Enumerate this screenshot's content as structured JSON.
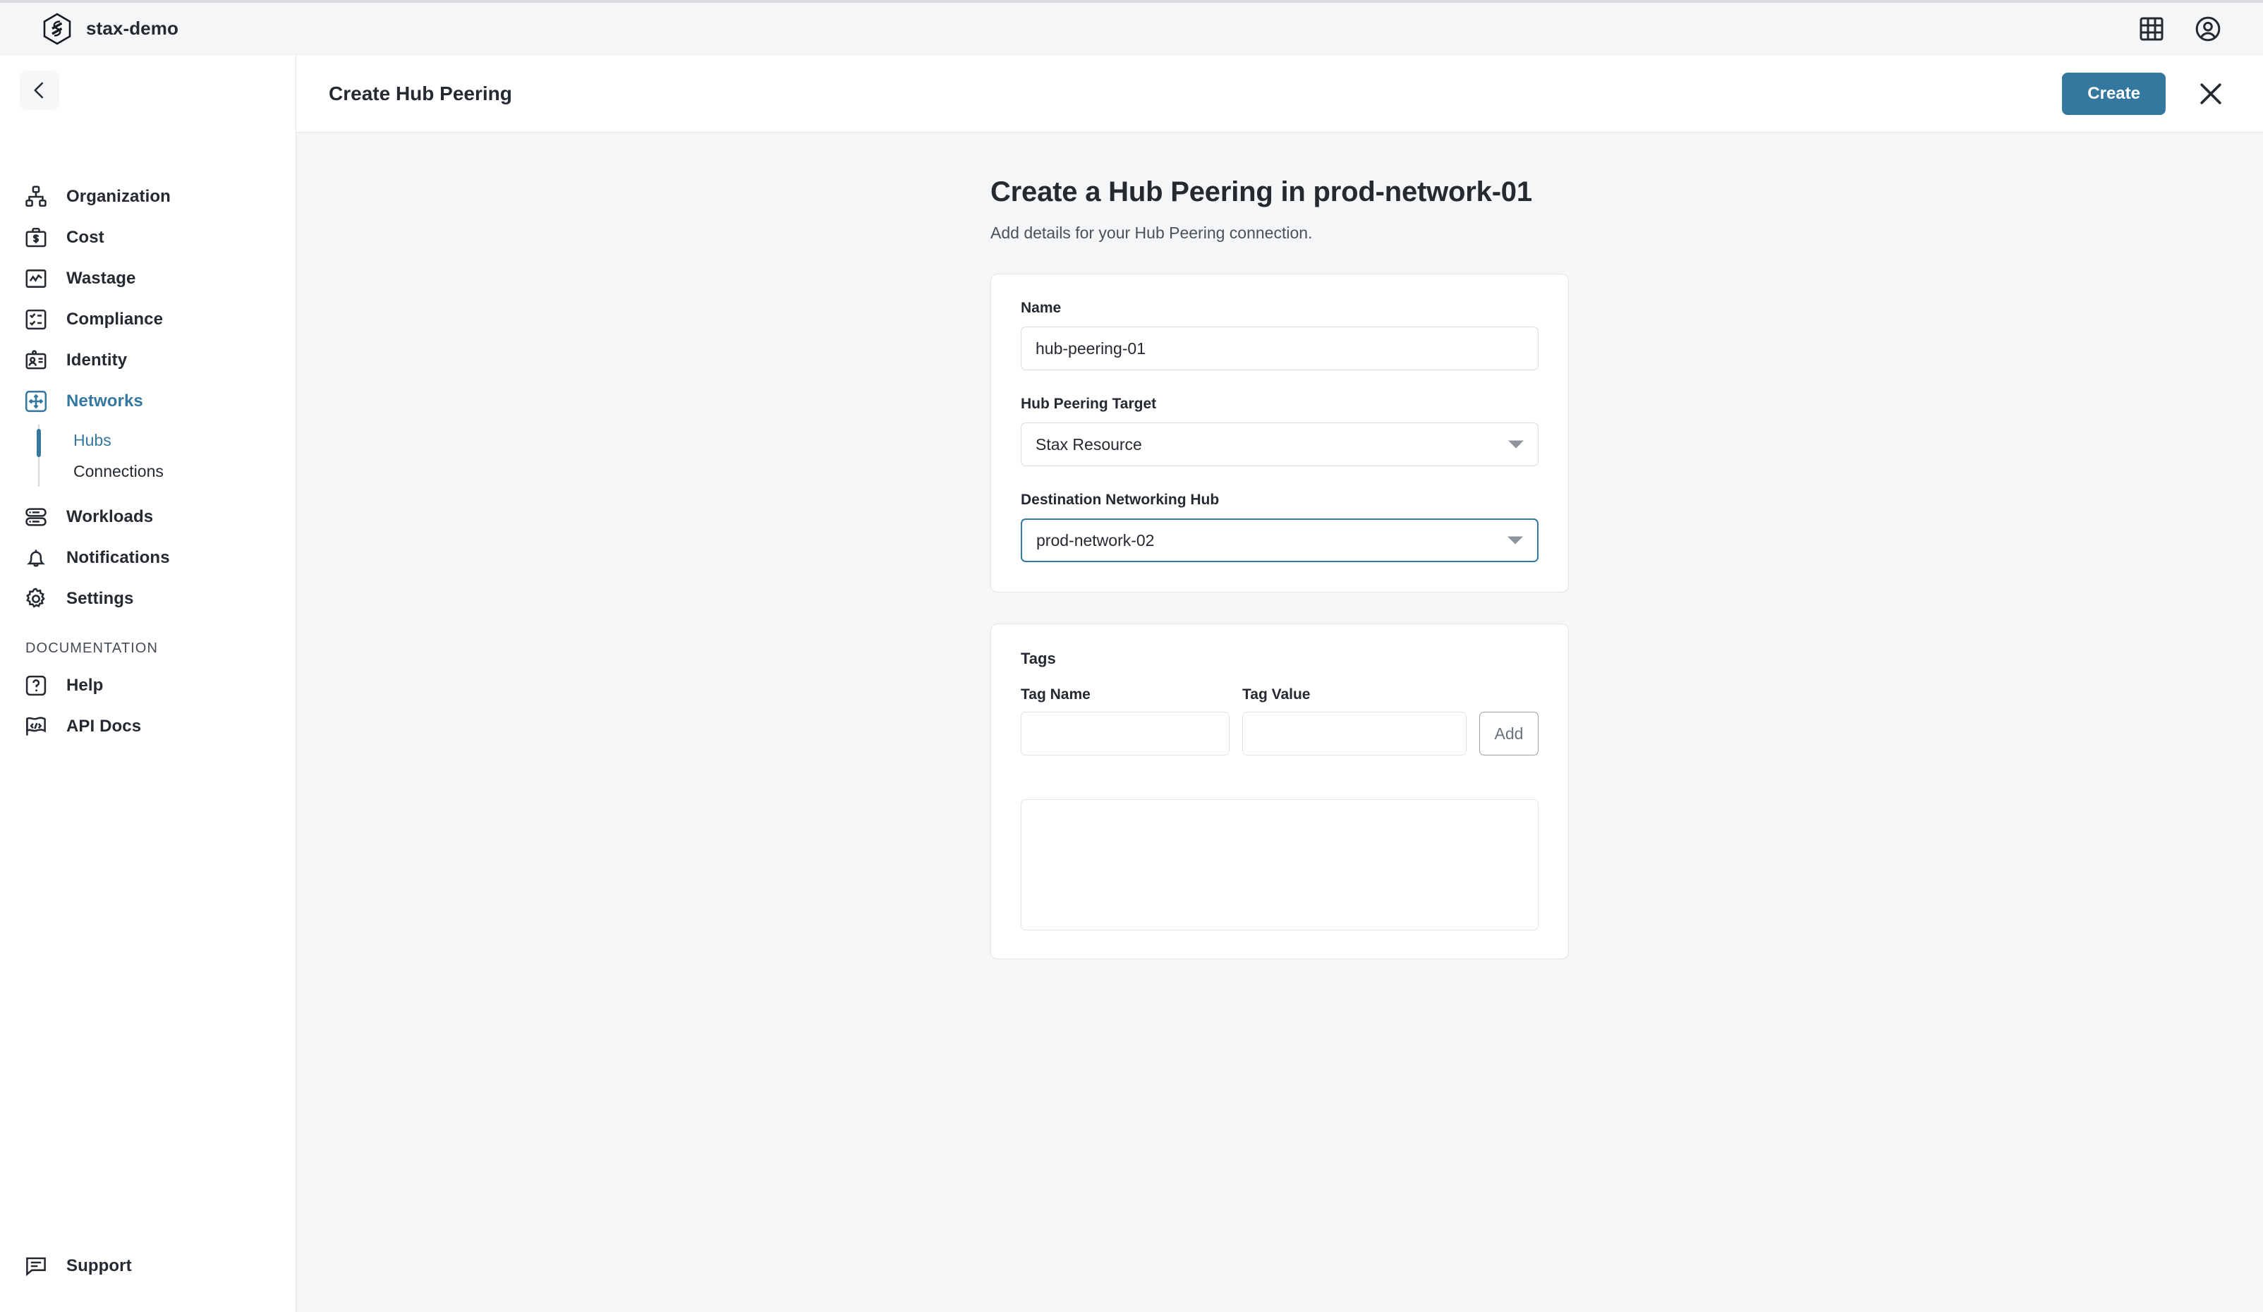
{
  "topbar": {
    "org_name": "stax-demo",
    "logo_icon": "stax-hexagon-logo",
    "grid_icon": "grid-apps-icon",
    "account_icon": "user-account-icon"
  },
  "sidebar": {
    "back_icon": "chevron-left-icon",
    "items": [
      {
        "label": "Organization",
        "icon": "org-chart-icon",
        "active": false
      },
      {
        "label": "Cost",
        "icon": "briefcase-dollar-icon",
        "active": false
      },
      {
        "label": "Wastage",
        "icon": "line-chart-icon",
        "active": false
      },
      {
        "label": "Compliance",
        "icon": "checklist-icon",
        "active": false
      },
      {
        "label": "Identity",
        "icon": "id-card-icon",
        "active": false
      },
      {
        "label": "Networks",
        "icon": "move-arrows-icon",
        "active": true
      }
    ],
    "subitems": [
      {
        "label": "Hubs",
        "active": true
      },
      {
        "label": "Connections",
        "active": false
      }
    ],
    "items_after": [
      {
        "label": "Workloads",
        "icon": "server-stack-icon",
        "active": false
      },
      {
        "label": "Notifications",
        "icon": "bell-icon",
        "active": false
      },
      {
        "label": "Settings",
        "icon": "gear-icon",
        "active": false
      }
    ],
    "section_label": "DOCUMENTATION",
    "doc_items": [
      {
        "label": "Help",
        "icon": "question-mark-icon",
        "active": false
      },
      {
        "label": "API Docs",
        "icon": "code-flag-icon",
        "active": false
      }
    ],
    "support": {
      "label": "Support",
      "icon": "chat-bubble-icon"
    }
  },
  "page_header": {
    "title": "Create Hub Peering",
    "create_label": "Create",
    "close_icon": "close-x-icon"
  },
  "form": {
    "heading": "Create a Hub Peering in prod-network-01",
    "subheading": "Add details for your Hub Peering connection.",
    "name_label": "Name",
    "name_value": "hub-peering-01",
    "name_placeholder": "",
    "target_label": "Hub Peering Target",
    "target_value": "Stax Resource",
    "destination_label": "Destination Networking Hub",
    "destination_value": "prod-network-02"
  },
  "tags": {
    "title": "Tags",
    "name_col_label": "Tag Name",
    "value_col_label": "Tag Value",
    "name_value": "",
    "name_placeholder": "",
    "value_value": "",
    "value_placeholder": "",
    "add_label": "Add"
  },
  "colors": {
    "accent": "#3478a0",
    "page_bg": "#f5f6f8",
    "card_bg": "#ffffff",
    "text": "#252a31",
    "border": "#e3e6ea"
  }
}
